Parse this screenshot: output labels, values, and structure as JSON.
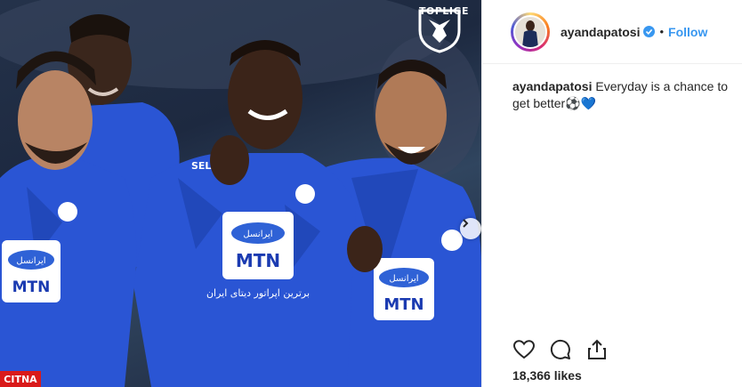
{
  "photo": {
    "watermark_text": "TOPLIGE",
    "corner_logo": "CITNA",
    "jersey_sponsor_top": "ایرانسل",
    "jersey_sponsor_bottom": "MTN",
    "jersey_slogan": "برترین اپراتور دیتای ایران",
    "jersey_maker": "SEL"
  },
  "post": {
    "username": "ayandapatosi",
    "verified": true,
    "separator": "•",
    "follow_label": "Follow",
    "caption_username": "ayandapatosi",
    "caption_text": "Everyday is a chance to get better⚽💙",
    "likes": "18,366 likes"
  },
  "icons": {
    "like": "heart-icon",
    "comment": "comment-icon",
    "share": "share-icon",
    "verified": "verified-badge-icon",
    "next": "chevron-right-icon"
  },
  "colors": {
    "jersey_blue": "#2a55d4",
    "follow_blue": "#3897f0",
    "text": "#262626"
  }
}
